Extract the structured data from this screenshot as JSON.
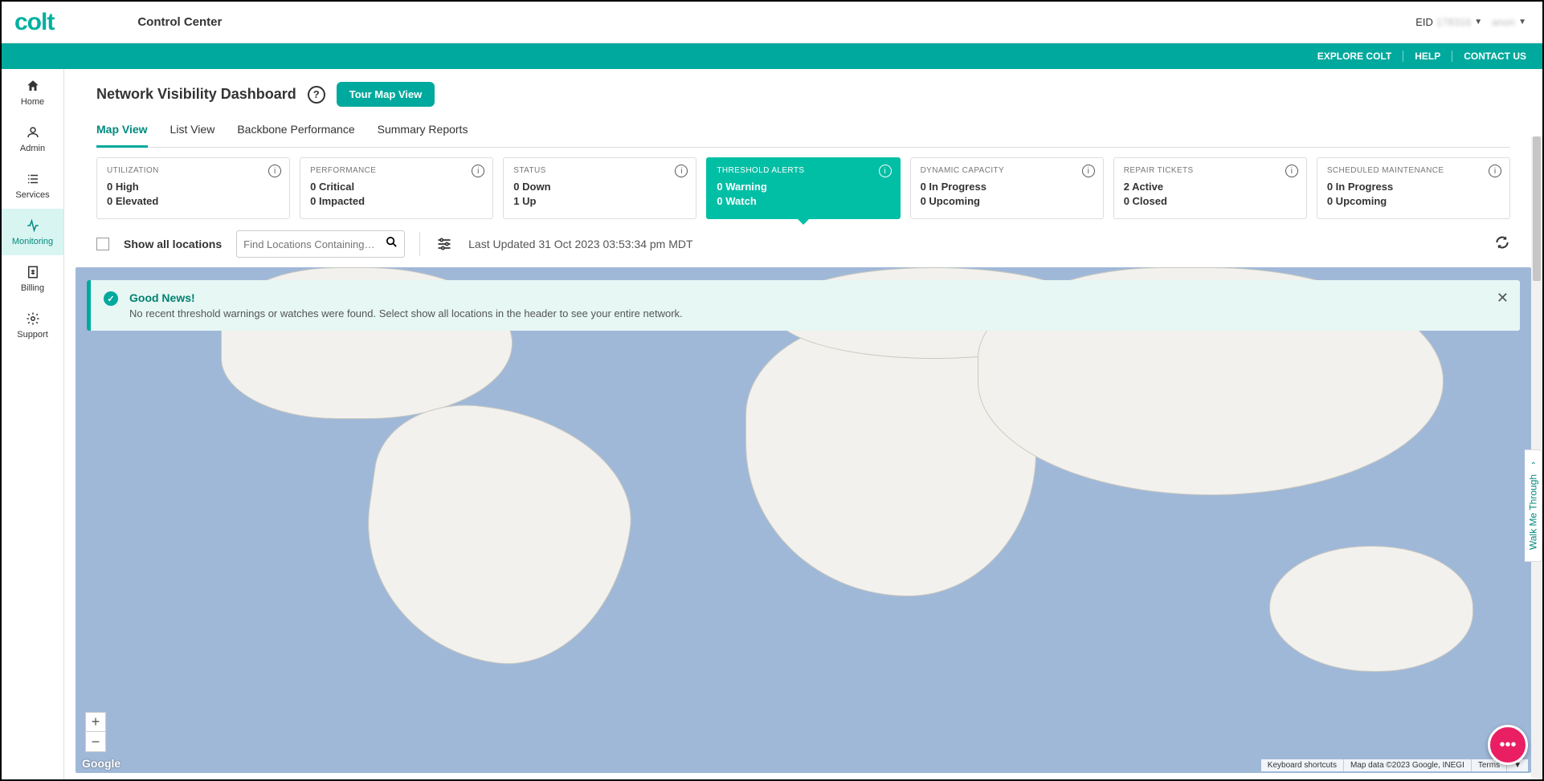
{
  "brand": "colt",
  "app_title": "Control Center",
  "header": {
    "eid_prefix": "EID",
    "eid_value": "178316",
    "user": "anon"
  },
  "linkbar": {
    "explore": "EXPLORE COLT",
    "help": "HELP",
    "contact": "CONTACT US"
  },
  "sidebar": [
    {
      "key": "home",
      "label": "Home"
    },
    {
      "key": "admin",
      "label": "Admin"
    },
    {
      "key": "services",
      "label": "Services"
    },
    {
      "key": "monitoring",
      "label": "Monitoring"
    },
    {
      "key": "billing",
      "label": "Billing"
    },
    {
      "key": "support",
      "label": "Support"
    }
  ],
  "page": {
    "title": "Network Visibility Dashboard",
    "tour_btn": "Tour Map View"
  },
  "tabs": [
    {
      "label": "Map View",
      "active": true
    },
    {
      "label": "List View"
    },
    {
      "label": "Backbone Performance"
    },
    {
      "label": "Summary Reports"
    }
  ],
  "cards": [
    {
      "key": "utilization",
      "title": "UTILIZATION",
      "line1": "0 High",
      "line2": "0 Elevated"
    },
    {
      "key": "performance",
      "title": "PERFORMANCE",
      "line1": "0 Critical",
      "line2": "0 Impacted"
    },
    {
      "key": "status",
      "title": "STATUS",
      "line1": "0 Down",
      "line2": "1 Up"
    },
    {
      "key": "threshold",
      "title": "THRESHOLD ALERTS",
      "line1": "0 Warning",
      "line2": "0 Watch",
      "active": true
    },
    {
      "key": "dynamic",
      "title": "DYNAMIC CAPACITY",
      "line1": "0 In Progress",
      "line2": "0 Upcoming"
    },
    {
      "key": "repair",
      "title": "REPAIR TICKETS",
      "line1": "2 Active",
      "line2": "0 Closed"
    },
    {
      "key": "maintenance",
      "title": "SCHEDULED MAINTENANCE",
      "line1": "0 In Progress",
      "line2": "0 Upcoming"
    }
  ],
  "filter": {
    "show_all": "Show all locations",
    "search_placeholder": "Find Locations Containing…",
    "last_updated": "Last Updated 31 Oct 2023 03:53:34 pm MDT"
  },
  "alert": {
    "title": "Good News!",
    "message": "No recent threshold warnings or watches were found. Select show all locations in the header to see your entire network."
  },
  "map": {
    "google": "Google",
    "footer": {
      "shortcuts": "Keyboard shortcuts",
      "data": "Map data ©2023 Google, INEGI",
      "terms": "Terms"
    }
  },
  "walk": "Walk Me Through"
}
